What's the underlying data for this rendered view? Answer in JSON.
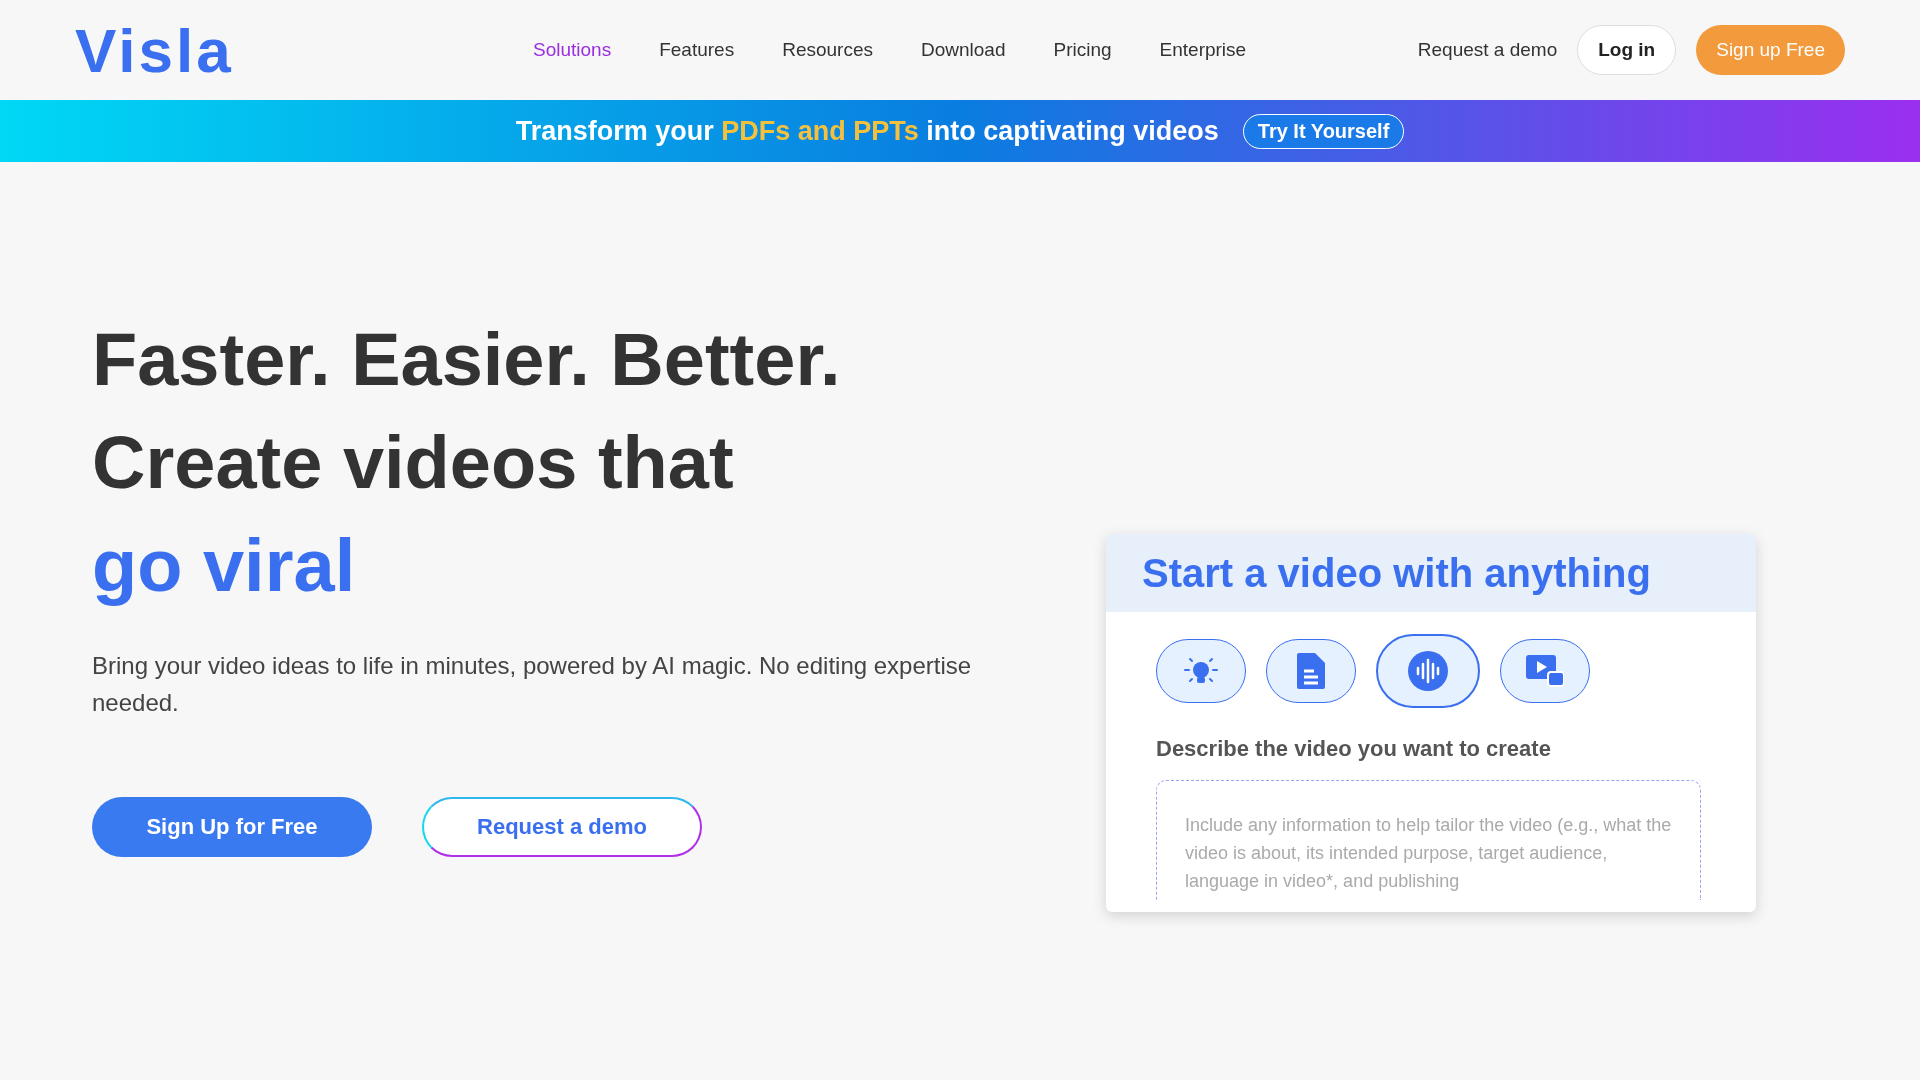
{
  "header": {
    "logo": "Visla",
    "nav": [
      {
        "label": "Solutions",
        "selected": true
      },
      {
        "label": "Features",
        "selected": false
      },
      {
        "label": "Resources",
        "selected": false
      },
      {
        "label": "Download",
        "selected": false
      },
      {
        "label": "Pricing",
        "selected": false
      },
      {
        "label": "Enterprise",
        "selected": false
      }
    ],
    "request_demo": "Request a demo",
    "login": "Log in",
    "signup": "Sign up Free"
  },
  "banner": {
    "text": "Transform your **PDFs and PPTs** into captivating videos",
    "button": "Try It Yourself"
  },
  "hero": {
    "lines": [
      "Faster. Easier. Better.",
      "Create videos that"
    ],
    "highlight": "go viral",
    "description": "Bring your video ideas to life in minutes, powered by AI magic. No editing expertise needed.",
    "primary_button": "Sign Up for Free",
    "secondary_button": "Request a demo"
  },
  "card": {
    "title": "Start a video with anything",
    "modes": [
      {
        "kind": "idea",
        "selected": false
      },
      {
        "kind": "document",
        "selected": false
      },
      {
        "kind": "audio",
        "selected": true
      },
      {
        "kind": "video",
        "selected": false
      }
    ],
    "prompt_label": "Describe the video you want to create",
    "placeholder": "Include any information to help tailor the video (e.g., what the video is about,  its intended purpose, target audience, language in video*, and publishing"
  }
}
